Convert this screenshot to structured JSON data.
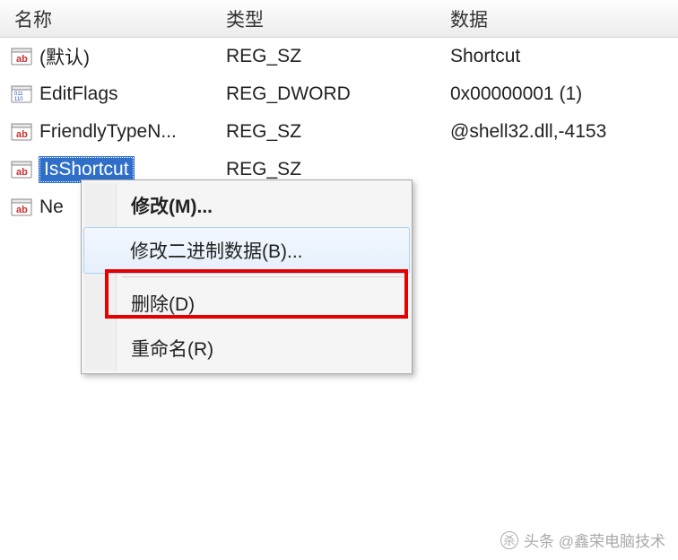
{
  "headers": {
    "name": "名称",
    "type": "类型",
    "data": "数据"
  },
  "rows": [
    {
      "icon": "string",
      "name": "(默认)",
      "type": "REG_SZ",
      "data": "Shortcut",
      "selected": false
    },
    {
      "icon": "binary",
      "name": "EditFlags",
      "type": "REG_DWORD",
      "data": "0x00000001 (1)",
      "selected": false
    },
    {
      "icon": "string",
      "name": "FriendlyTypeN...",
      "type": "REG_SZ",
      "data": "@shell32.dll,-4153",
      "selected": false
    },
    {
      "icon": "string",
      "name": "IsShortcut",
      "type": "REG_SZ",
      "data": "",
      "selected": true
    },
    {
      "icon": "string",
      "name": "Ne",
      "type": "",
      "data": "",
      "selected": false
    }
  ],
  "context_menu": {
    "items": [
      {
        "label": "修改(M)...",
        "bold": true,
        "hovered": false
      },
      {
        "label": "修改二进制数据(B)...",
        "bold": false,
        "hovered": true
      },
      {
        "separator": true
      },
      {
        "label": "删除(D)",
        "bold": false,
        "hovered": false
      },
      {
        "label": "重命名(R)",
        "bold": false,
        "hovered": false
      }
    ]
  },
  "watermark": "头条 @鑫荣电脑技术"
}
